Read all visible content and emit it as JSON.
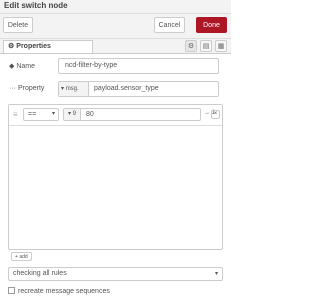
{
  "dialog": {
    "title": "Edit switch node"
  },
  "toolbar": {
    "delete_label": "Delete",
    "cancel_label": "Cancel",
    "done_label": "Done"
  },
  "tabs": {
    "properties_label": "Properties"
  },
  "form": {
    "name_label": "Name",
    "name_value": "ncd-filter-by-type",
    "property_label": "Property",
    "property_type": "msg.",
    "property_value": "payload.sensor_type"
  },
  "rule": {
    "operator": "==",
    "value_type": "9",
    "value": "80",
    "output": "1",
    "delete_glyph": "×"
  },
  "rules_add_label": "add",
  "checking": {
    "selected": "checking all rules"
  },
  "recreate": {
    "label": "recreate message sequences"
  },
  "colors": {
    "accent": "#ad1625"
  }
}
